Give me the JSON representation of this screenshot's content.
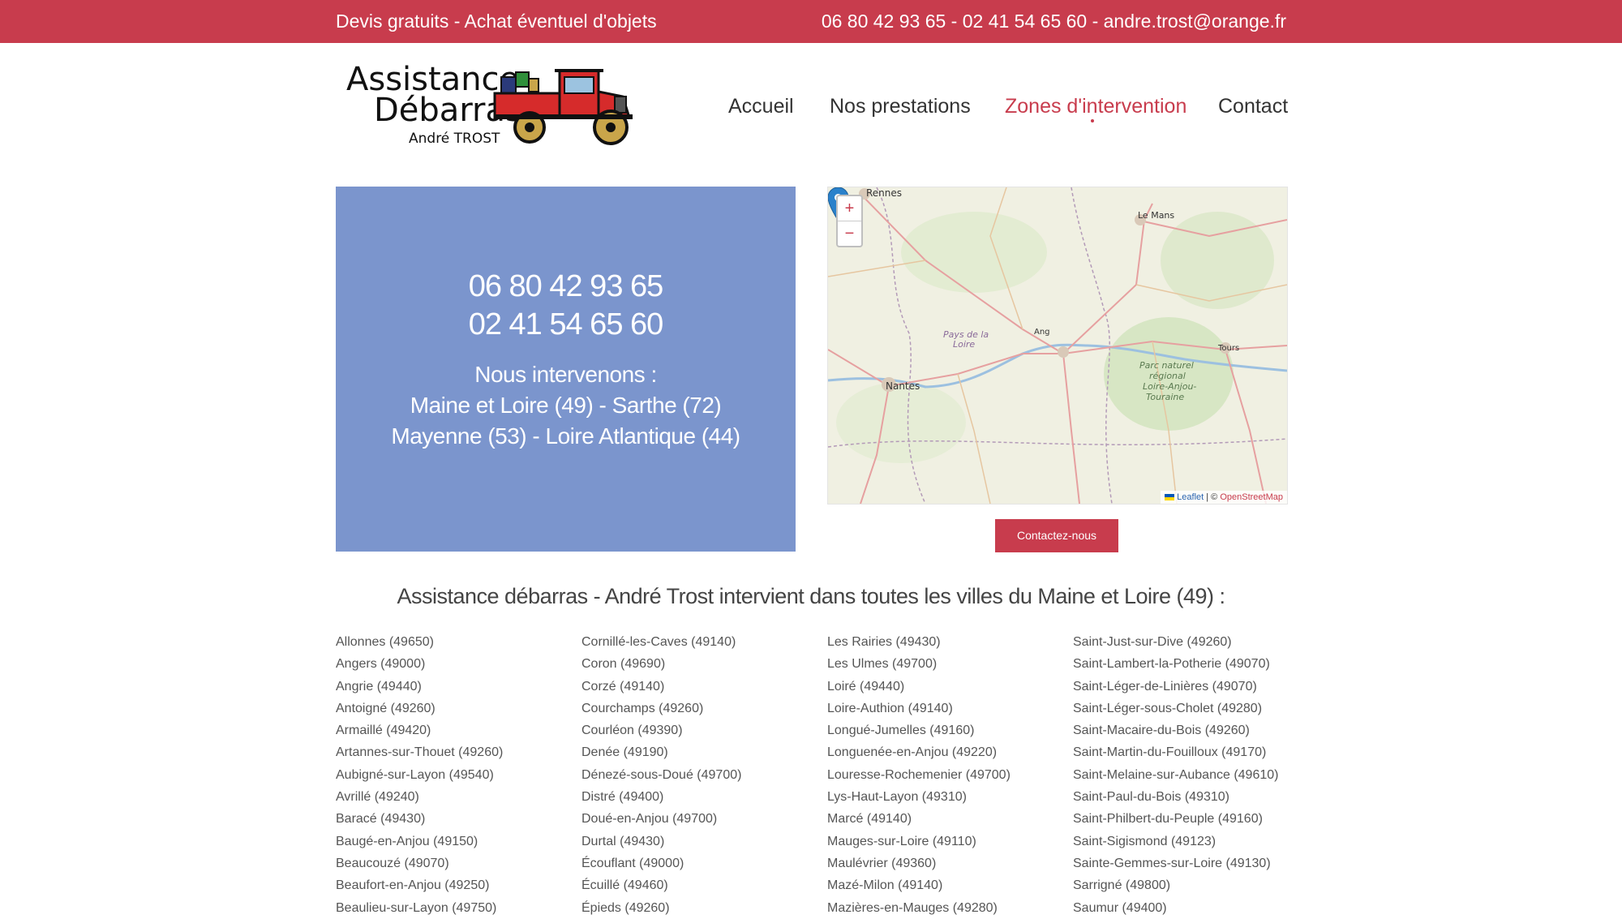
{
  "topbar": {
    "left_text": "Devis gratuits - Achat éventuel d'objets",
    "right_text": "06 80 42 93 65 - 02 41 54 65 60 - andre.trost@orange.fr"
  },
  "logo": {
    "line1": "Assistance",
    "line2": "Débarras",
    "line3": "André TROST"
  },
  "nav": {
    "items": [
      "Accueil",
      "Nos prestations",
      "Zones d'intervention",
      "Contact"
    ],
    "active": "Zones d'intervention"
  },
  "bluebox": {
    "phone1": "06 80 42 93 65",
    "phone2": "02 41 54 65 60",
    "line1": "Nous intervenons :",
    "line2": "Maine et Loire (49) - Sarthe (72)",
    "line3": "Mayenne (53) - Loire Atlantique (44)"
  },
  "map": {
    "zoom_in": "+",
    "zoom_out": "−",
    "labels": {
      "rennes": "Rennes",
      "le_mans": "Le Mans",
      "nantes": "Nantes",
      "tours": "Tours",
      "angers": "Ang",
      "pays_de_la_loire_1": "Pays de la",
      "pays_de_la_loire_2": "Loire",
      "parc_1": "Parc naturel",
      "parc_2": "régional",
      "parc_3": "Loire-Anjou-",
      "parc_4": "Touraine"
    },
    "attribution_leaflet": "Leaflet",
    "attribution_sep": "| ©",
    "attribution_osm": "OpenStreetMap"
  },
  "contact_button": "Contactez-nous",
  "heading": "Assistance débarras - André Trost intervient dans toutes les villes du Maine et Loire (49) :",
  "towns": {
    "col1": [
      "Allonnes (49650)",
      "Angers (49000)",
      "Angrie (49440)",
      "Antoigné (49260)",
      "Armaillé (49420)",
      "Artannes-sur-Thouet (49260)",
      "Aubigné-sur-Layon (49540)",
      "Avrillé (49240)",
      "Baracé (49430)",
      "Baugé-en-Anjou (49150)",
      "Beaucouzé (49070)",
      "Beaufort-en-Anjou (49250)",
      "Beaulieu-sur-Layon (49750)"
    ],
    "col2": [
      "Cornillé-les-Caves (49140)",
      "Coron (49690)",
      "Corzé (49140)",
      "Courchamps (49260)",
      "Courléon (49390)",
      "Denée (49190)",
      "Dénezé-sous-Doué (49700)",
      "Distré (49400)",
      "Doué-en-Anjou (49700)",
      "Durtal (49430)",
      "Écouflant (49000)",
      "Écuillé (49460)",
      "Épieds (49260)"
    ],
    "col3": [
      "Les Rairies (49430)",
      "Les Ulmes (49700)",
      "Loiré (49440)",
      "Loire-Authion (49140)",
      "Longué-Jumelles (49160)",
      "Longuenée-en-Anjou (49220)",
      "Louresse-Rochemenier (49700)",
      "Lys-Haut-Layon (49310)",
      "Marcé (49140)",
      "Mauges-sur-Loire (49110)",
      "Maulévrier (49360)",
      "Mazé-Milon (49140)",
      "Mazières-en-Mauges (49280)"
    ],
    "col4": [
      "Saint-Just-sur-Dive (49260)",
      "Saint-Lambert-la-Potherie (49070)",
      "Saint-Léger-de-Linières (49070)",
      "Saint-Léger-sous-Cholet (49280)",
      "Saint-Macaire-du-Bois (49260)",
      "Saint-Martin-du-Fouilloux (49170)",
      "Saint-Melaine-sur-Aubance (49610)",
      "Saint-Paul-du-Bois (49310)",
      "Saint-Philbert-du-Peuple (49160)",
      "Saint-Sigismond (49123)",
      "Sainte-Gemmes-sur-Loire (49130)",
      "Sarrigné (49800)",
      "Saumur (49400)"
    ]
  },
  "colors": {
    "accent": "#c83c4d",
    "blue_box": "#7b95cd",
    "map_pin": "#2a81cb"
  }
}
